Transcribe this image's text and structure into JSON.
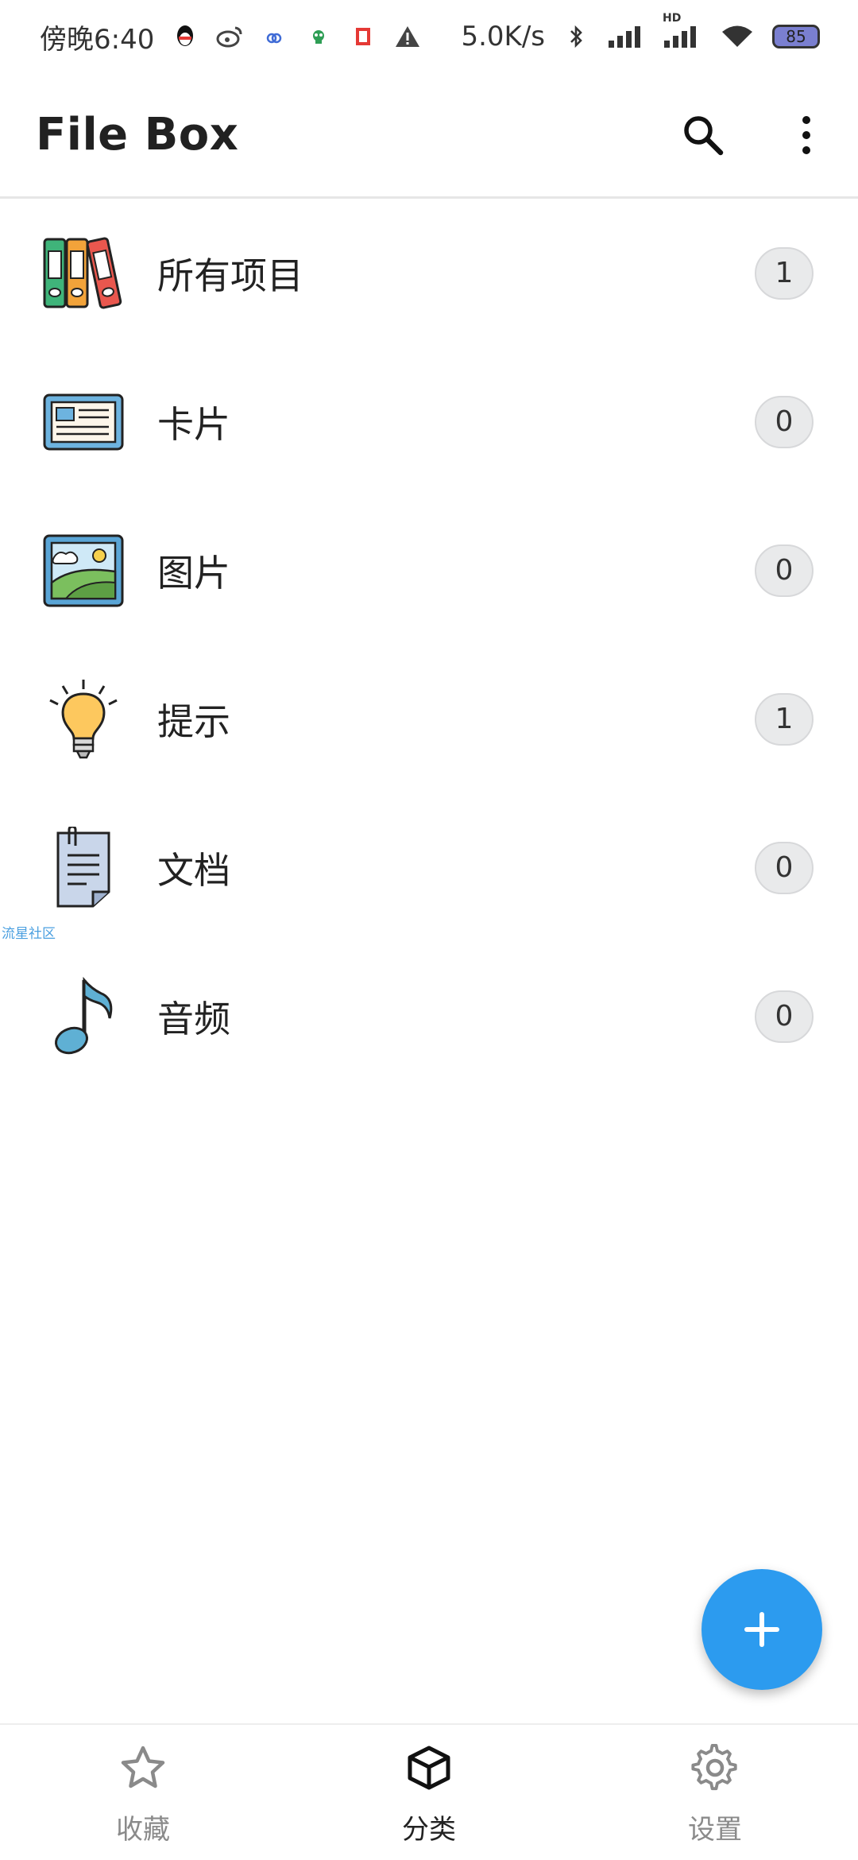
{
  "status_bar": {
    "time": "傍晚6:40",
    "net_speed": "5.0K/s",
    "hd_label": "HD",
    "battery": "85"
  },
  "app_bar": {
    "title": "File Box"
  },
  "categories": [
    {
      "label": "所有项目",
      "count": "1",
      "icon": "binders-icon"
    },
    {
      "label": "卡片",
      "count": "0",
      "icon": "card-icon"
    },
    {
      "label": "图片",
      "count": "0",
      "icon": "picture-icon"
    },
    {
      "label": "提示",
      "count": "1",
      "icon": "lightbulb-icon"
    },
    {
      "label": "文档",
      "count": "0",
      "icon": "document-icon"
    },
    {
      "label": "音频",
      "count": "0",
      "icon": "music-note-icon"
    }
  ],
  "watermark": "流星社区",
  "fab": {
    "icon": "plus-icon"
  },
  "bottom_nav": {
    "items": [
      {
        "label": "收藏",
        "icon": "star-icon",
        "active": false
      },
      {
        "label": "分类",
        "icon": "box-icon",
        "active": true
      },
      {
        "label": "设置",
        "icon": "gear-icon",
        "active": false
      }
    ]
  },
  "colors": {
    "accent": "#2c9bef",
    "badge_bg": "#e9eaeb"
  }
}
